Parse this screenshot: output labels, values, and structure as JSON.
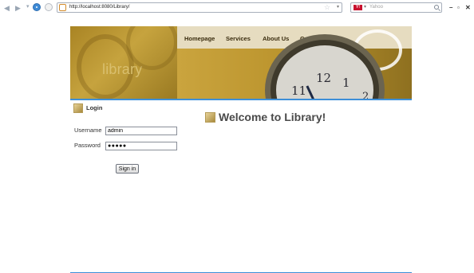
{
  "browser": {
    "url": "http://localhost:8080/Library/",
    "search_placeholder": "Yahoo",
    "search_engine": "Y!",
    "buttons": {
      "minimize": "–",
      "restore": "▫",
      "close": "✕"
    }
  },
  "header": {
    "logo_text": "library",
    "nav": [
      "Homepage",
      "Services",
      "About Us",
      "Contact Us"
    ],
    "clock_numerals": [
      "11",
      "12",
      "1",
      "2"
    ],
    "accent_color": "#3d8fd8"
  },
  "login": {
    "title": "Login",
    "username_label": "Username",
    "username_value": "admin",
    "password_label": "Password",
    "password_value": "●●●●●",
    "button_label": "Sign in"
  },
  "welcome": {
    "title": "Welcome to Library!"
  }
}
